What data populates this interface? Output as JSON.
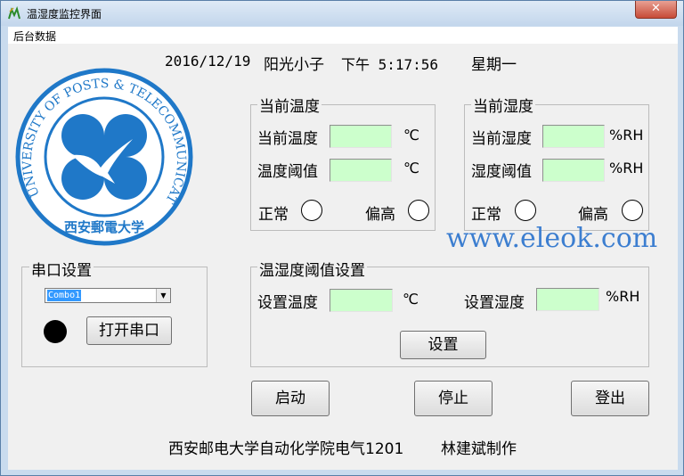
{
  "window": {
    "title": "温湿度监控界面",
    "close_label": "✕"
  },
  "menu": {
    "items": [
      {
        "label": "后台数据"
      }
    ]
  },
  "header": {
    "date": "2016/12/19",
    "author": "阳光小子",
    "time": "下午 5:17:56",
    "weekday": "星期一"
  },
  "temp_group": {
    "title": "当前温度",
    "current_label": "当前温度",
    "current_unit": "℃",
    "threshold_label": "温度阈值",
    "threshold_unit": "℃",
    "normal_label": "正常",
    "high_label": "偏高"
  },
  "hum_group": {
    "title": "当前湿度",
    "current_label": "当前湿度",
    "current_unit": "%RH",
    "threshold_label": "湿度阈值",
    "threshold_unit": "%RH",
    "normal_label": "正常",
    "high_label": "偏高"
  },
  "watermark": "www.eleok.com",
  "serial_group": {
    "title": "串口设置",
    "port_value": "Combo1",
    "open_button": "打开串口"
  },
  "threshold_group": {
    "title": "温湿度阈值设置",
    "set_temp_label": "设置温度",
    "set_temp_unit": "℃",
    "set_hum_label": "设置湿度",
    "set_hum_unit": "%RH",
    "set_button": "设置"
  },
  "actions": {
    "start": "启动",
    "stop": "停止",
    "logout": "登出"
  },
  "footer": {
    "credit": "西安邮电大学自动化学院电气1201",
    "author": "林建斌制作"
  },
  "logo": {
    "outer_text": "XI'AN UNIVERSITY OF POSTS & TELECOMMUNICATIONS",
    "inner_text": "西安郵電大学"
  },
  "colors": {
    "field_bg": "#ccffcc",
    "logo_blue": "#1f78c8",
    "watermark": "#3c7ed0",
    "led_serial": "#000000"
  }
}
